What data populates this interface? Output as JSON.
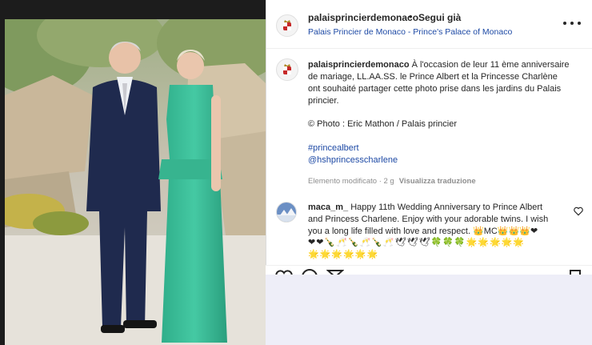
{
  "post": {
    "username": "palaisprincierdemonaco",
    "dot": "•",
    "follow_label": "Segui già",
    "location": "Palais Princier de Monaco - Prince's Palace of Monaco",
    "image_alt": "Prince Albert and Princess Charlène in the gardens of the Palace"
  },
  "caption": {
    "username": "palaisprincierdemonaco",
    "lines": [
      " À l'occasion de leur 11 ème anniversaire",
      "de mariage, LL.AA.SS. le Prince Albert et la Princesse Charlène",
      "ont souhaité partager cette photo prise dans les jardins du Palais",
      "princier."
    ],
    "credit": "© Photo : Eric Mathon / Palais princier",
    "hashtags": [
      "#princealbert",
      "@hshprincesscharlene"
    ],
    "edited": "Elemento modificato · 2 g",
    "translate_label": "Visualizza traduzione"
  },
  "comment": {
    "username": "maca_m_",
    "lines": [
      "  Happy 11th Wedding Anniversary to Prince Albert",
      "and Princess Charlene. Enjoy with your adorable twins. I wish",
      "you a long life filled with love and respect. 👑MC👑👑👑❤"
    ],
    "emoji_lines": [
      "❤❤🍾🥂🍾🥂🍾🥂🕊🕊🕊🍀🍀🍀🌟🌟🌟🌟🌟",
      "🌟🌟🌟🌟🌟🌟"
    ]
  },
  "icons": {
    "more": "more-options-icon",
    "like": "heart-icon",
    "comment": "comment-icon",
    "share": "share-icon",
    "save": "bookmark-icon"
  },
  "colors": {
    "link": "#1e4aa5",
    "text": "#262626",
    "muted": "#8e8e8e",
    "dress": "#3dbf98",
    "suit": "#1f2a4e"
  }
}
